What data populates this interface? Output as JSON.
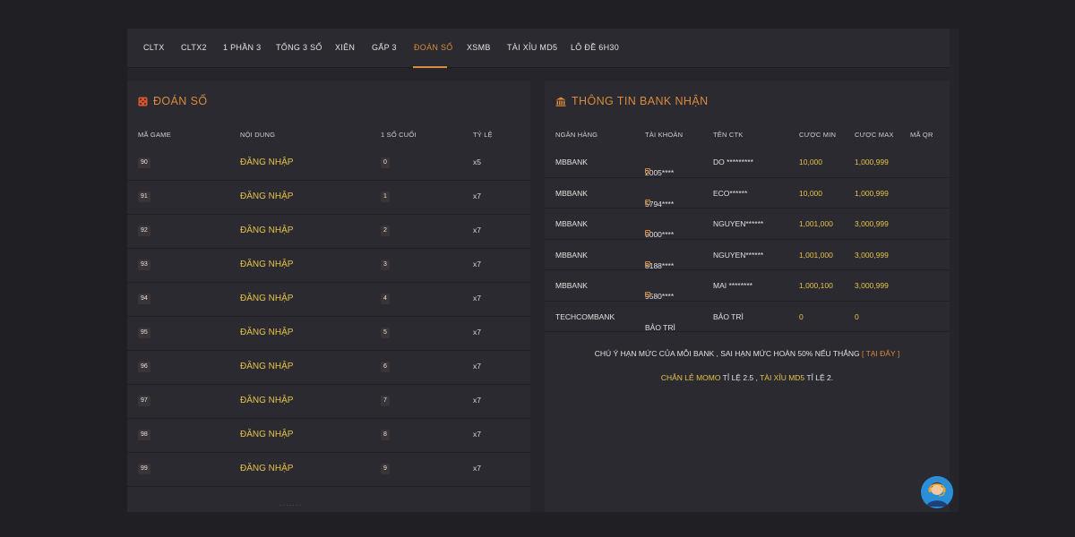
{
  "nav": {
    "items": [
      {
        "label": "CLTX"
      },
      {
        "label": "CLTX2"
      },
      {
        "label": "1 PHẦN 3"
      },
      {
        "label": "TỔNG 3 SỐ"
      },
      {
        "label": "XIÊN"
      },
      {
        "label": "GẤP 3"
      },
      {
        "label": "ĐOÁN SỐ"
      },
      {
        "label": "XSMB"
      },
      {
        "label": "TÀI XỈU MD5"
      },
      {
        "label": "LÔ ĐỀ 6H30"
      }
    ],
    "active_index": 6
  },
  "left_panel": {
    "title": "ĐOÁN SỐ",
    "headers": {
      "game_code": "MÃ GAME",
      "content": "NỘI DUNG",
      "last_digit": "1 SỐ CUỐI",
      "rate": "TỶ LỆ"
    },
    "rows": [
      {
        "code": "90",
        "content": "ĐĂNG NHẬP",
        "digit": "0",
        "rate": "x5"
      },
      {
        "code": "91",
        "content": "ĐĂNG NHẬP",
        "digit": "1",
        "rate": "x7"
      },
      {
        "code": "92",
        "content": "ĐĂNG NHẬP",
        "digit": "2",
        "rate": "x7"
      },
      {
        "code": "93",
        "content": "ĐĂNG NHẬP",
        "digit": "3",
        "rate": "x7"
      },
      {
        "code": "94",
        "content": "ĐĂNG NHẬP",
        "digit": "4",
        "rate": "x7"
      },
      {
        "code": "95",
        "content": "ĐĂNG NHẬP",
        "digit": "5",
        "rate": "x7"
      },
      {
        "code": "96",
        "content": "ĐĂNG NHẬP",
        "digit": "6",
        "rate": "x7"
      },
      {
        "code": "97",
        "content": "ĐĂNG NHẬP",
        "digit": "7",
        "rate": "x7"
      },
      {
        "code": "98",
        "content": "ĐĂNG NHẬP",
        "digit": "8",
        "rate": "x7"
      },
      {
        "code": "99",
        "content": "ĐĂNG NHẬP",
        "digit": "9",
        "rate": "x7"
      }
    ]
  },
  "right_panel": {
    "title": "THÔNG TIN BANK NHẬN",
    "headers": {
      "bank": "NGÂN HÀNG",
      "account": "TÀI KHOẢN",
      "owner": "TÊN CTK",
      "min": "CƯỢC MIN",
      "max": "CƯỢC MAX",
      "qr": "MÃ QR"
    },
    "rows": [
      {
        "bank": "MBBANK",
        "account": "2005****",
        "copy": true,
        "owner": "DO *********",
        "min": "10,000",
        "max": "1,000,999"
      },
      {
        "bank": "MBBANK",
        "account": "5794****",
        "copy": true,
        "owner": "ECO******",
        "min": "10,000",
        "max": "1,000,999"
      },
      {
        "bank": "MBBANK",
        "account": "0000****",
        "copy": true,
        "owner": "NGUYEN******",
        "min": "1,001,000",
        "max": "3,000,999"
      },
      {
        "bank": "MBBANK",
        "account": "8188****",
        "copy": true,
        "owner": "NGUYEN******",
        "min": "1,001,000",
        "max": "3,000,999"
      },
      {
        "bank": "MBBANK",
        "account": "9580****",
        "copy": true,
        "owner": "MAI ********",
        "min": "1,000,100",
        "max": "3,000,999"
      },
      {
        "bank": "TECHCOMBANK",
        "account": "BẢO TRÌ",
        "copy": false,
        "owner": "BẢO TRÌ",
        "min": "0",
        "max": "0"
      }
    ],
    "note1": {
      "text": "CHÚ Ý HẠN MỨC CỦA MỖI BANK , SAI HẠN MỨC HOÀN 50% NẾU THẮNG ",
      "link": "[ TẠI ĐÂY ]"
    },
    "note2": {
      "hl1": "CHẴN LẺ MOMO",
      "t1": " TỈ LỆ 2.5 , ",
      "hl2": "TÀI XỈU MD5",
      "t2": " TỈ LỆ 2."
    }
  },
  "colors": {
    "accent": "#d98a3d",
    "highlight": "#e6c34a",
    "background": "#1f1f24",
    "panel": "#2a2a30"
  },
  "icons": {
    "left_title": "dice-icon",
    "right_title": "bank-icon",
    "chat": "support-agent-icon"
  }
}
